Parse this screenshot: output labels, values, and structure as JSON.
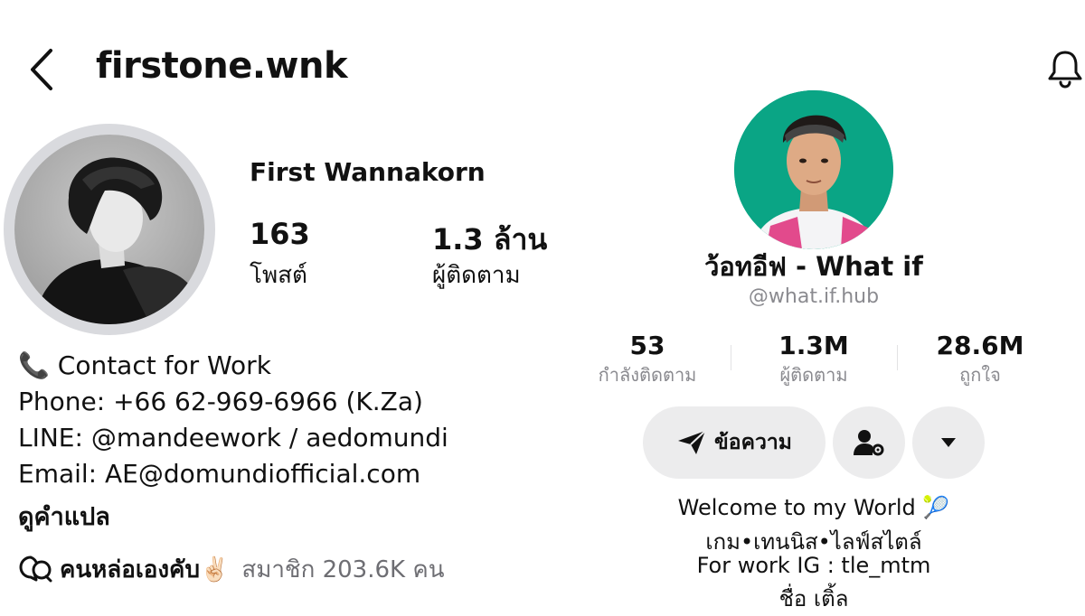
{
  "instagram": {
    "username": "firstone.wnk",
    "full_name": "First Wannakorn",
    "posts_count": "163",
    "posts_label": "โพสต์",
    "followers_count": "1.3 ล้าน",
    "followers_label": "ผู้ติดตาม",
    "bio": {
      "contact": "📞 Contact for Work",
      "phone": "Phone: +66 62-969-6966 (K.Za)",
      "line": "LINE: @mandeework / aedomundi",
      "email": "Email: AE@domundiofficial.com"
    },
    "translate_label": "ดูคำแปล",
    "channel": {
      "name": "คนหล่อเองคับ✌🏻",
      "members": "สมาชิก 203.6K คน"
    },
    "icons": [
      "back-icon",
      "channel-chat-icon"
    ]
  },
  "tiktok": {
    "display_name": "ว้อทอีฟ - What if",
    "handle": "@what.if.hub",
    "stats": {
      "following": {
        "value": "53",
        "label": "กำลังติดตาม"
      },
      "followers": {
        "value": "1.3M",
        "label": "ผู้ติดตาม"
      },
      "likes": {
        "value": "28.6M",
        "label": "ถูกใจ"
      }
    },
    "message_button_label": "ข้อความ",
    "bio_lines": [
      "Welcome to my World 🎾",
      "เกม•เทนนิส•ไลฟ์สไตล์",
      "For work IG : tle_mtm",
      "ชื่อ เติ้ล"
    ],
    "icons": [
      "bell-icon",
      "send-icon",
      "user-settings-icon",
      "caret-down-icon"
    ],
    "avatar_bg_color": "#0aa585"
  }
}
